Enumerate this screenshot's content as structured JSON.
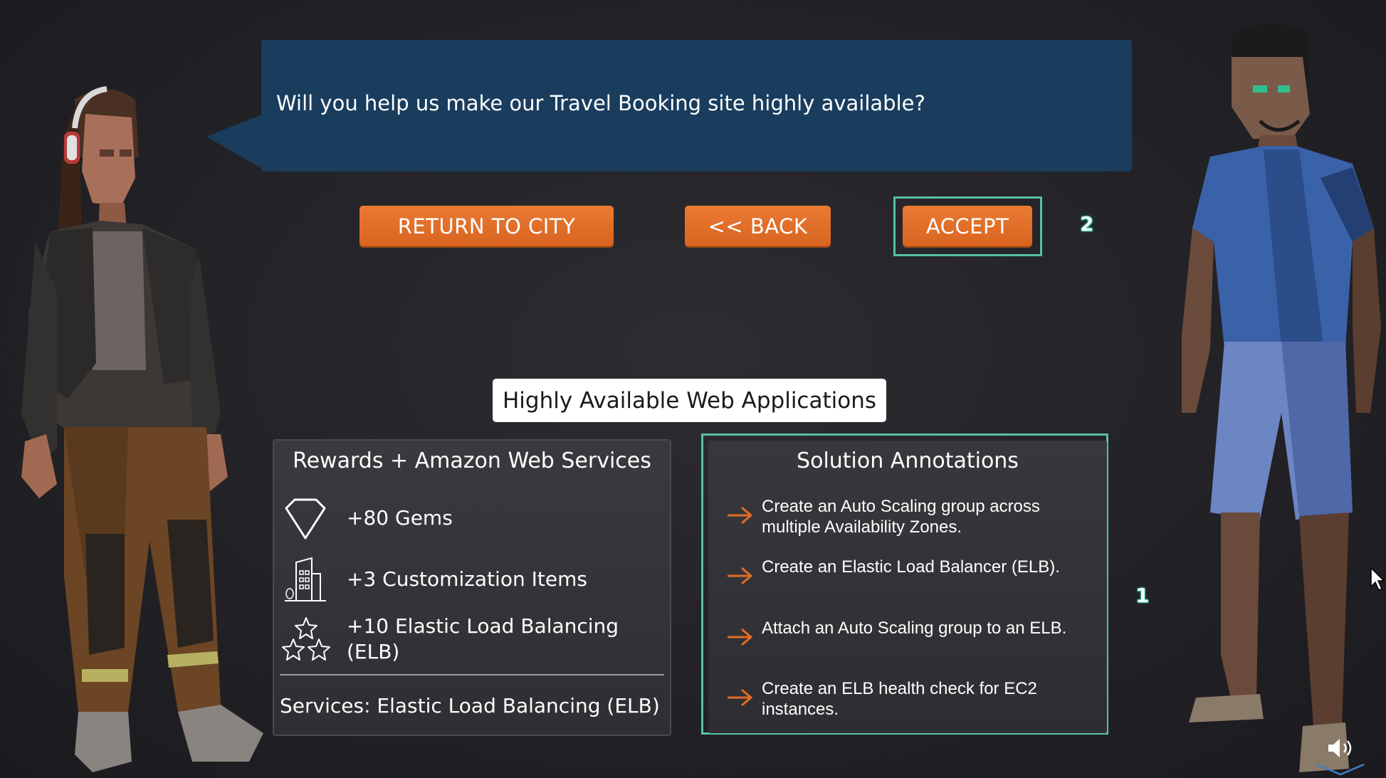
{
  "dialog": {
    "text": "Will you help us make our Travel Booking site highly available?"
  },
  "buttons": {
    "return_to_city": "RETURN TO CITY",
    "back": "<< BACK",
    "accept": "ACCEPT"
  },
  "markers": {
    "accept_marker": "2",
    "panel_marker": "1"
  },
  "mission": {
    "title": "Highly Available Web Applications"
  },
  "rewards": {
    "title": "Rewards + Amazon Web Services",
    "items": [
      {
        "icon": "gem-icon",
        "text": "+80 Gems"
      },
      {
        "icon": "building-icon",
        "text": "+3 Customization Items"
      },
      {
        "icon": "stars-icon",
        "text": "+10 Elastic Load Balancing (ELB)"
      }
    ],
    "services": "Services: Elastic Load Balancing (ELB)"
  },
  "solution": {
    "title": "Solution Annotations",
    "items": [
      "Create an Auto Scaling group across multiple Availability Zones.",
      "Create an Elastic Load Balancer (ELB).",
      "Attach an Auto Scaling group to an ELB.",
      "Create an ELB health check for EC2 instances."
    ]
  },
  "colors": {
    "button_orange": "#e06d28",
    "dialog_blue": "#1a3d5e",
    "highlight_teal": "#55c1a2",
    "arrow_orange": "#e06d28"
  }
}
